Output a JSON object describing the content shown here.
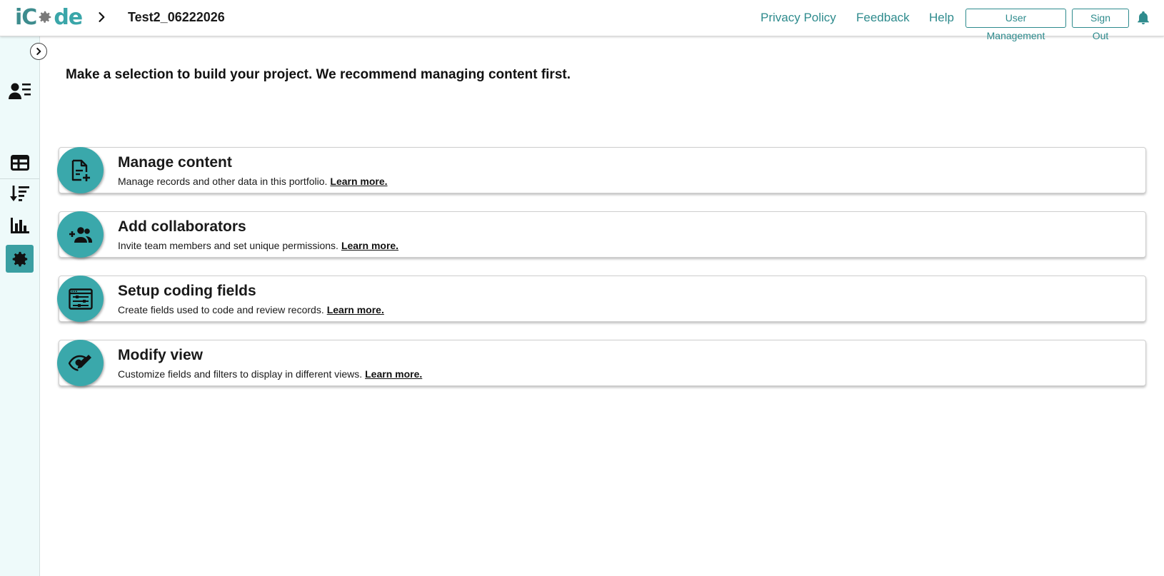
{
  "header": {
    "logo_text": "iCode",
    "project_title": "Test2_06222026",
    "links": {
      "privacy": "Privacy Policy",
      "feedback": "Feedback",
      "help": "Help"
    },
    "buttons": {
      "user_management": "User Management",
      "sign_out": "Sign Out"
    }
  },
  "sidebar": {
    "icons": [
      "user-list-icon",
      "table-icon",
      "sort-icon",
      "bar-chart-icon",
      "settings-icon"
    ],
    "active": "settings-icon"
  },
  "main": {
    "intro": "Make a selection to build your project. We recommend managing content first.",
    "cards": [
      {
        "title": "Manage content",
        "desc": "Manage records and other data in this portfolio.",
        "link": "Learn more.",
        "icon": "file-add-icon"
      },
      {
        "title": "Add collaborators",
        "desc": "Invite team members and set unique permissions.",
        "link": "Learn more.",
        "icon": "add-group-icon"
      },
      {
        "title": "Setup coding fields",
        "desc": "Create fields used to code and review records.",
        "link": "Learn more.",
        "icon": "form-sliders-icon"
      },
      {
        "title": "Modify view",
        "desc": "Customize fields and filters to display in different views.",
        "link": "Learn more.",
        "icon": "eye-edit-icon"
      }
    ]
  },
  "colors": {
    "accent": "#3aa8ab",
    "link": "#2e8b8d",
    "sidebar_bg": "#eefafa"
  }
}
